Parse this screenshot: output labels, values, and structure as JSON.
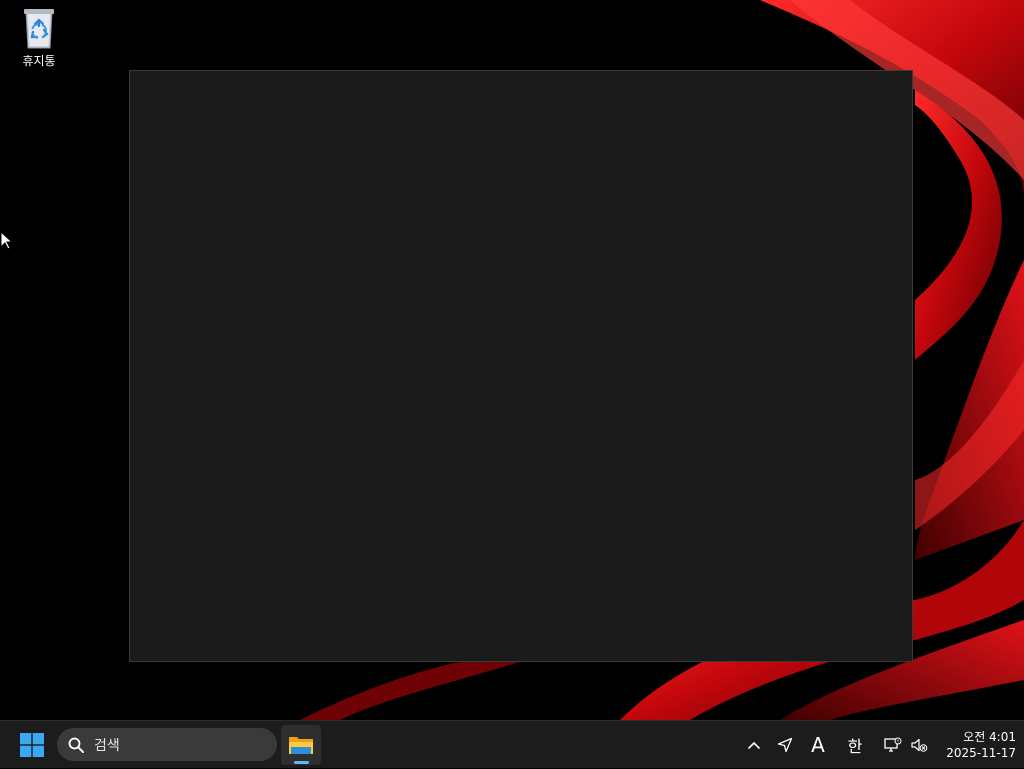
{
  "desktop": {
    "icons": [
      {
        "label": "휴지통",
        "icon": "recycle-bin-icon"
      }
    ],
    "wallpaper": {
      "accent": "#d40f14",
      "background": "#000000"
    }
  },
  "window": {
    "background": "#1b1b1b"
  },
  "taskbar": {
    "start_icon": "windows-logo-icon",
    "search": {
      "placeholder": "검색",
      "icon": "search-icon"
    },
    "pinned_apps": [
      {
        "name": "file-explorer",
        "icon": "folder-icon",
        "running": true
      }
    ],
    "tray": {
      "chevron_icon": "chevron-up-icon",
      "location_icon": "location-arrow-icon",
      "font_label": "A",
      "ime_label": "한",
      "network_icon": "network-disconnected-icon",
      "volume_icon": "volume-muted-icon"
    },
    "clock": {
      "time": "오전 4:01",
      "date": "2025-11-17"
    }
  }
}
